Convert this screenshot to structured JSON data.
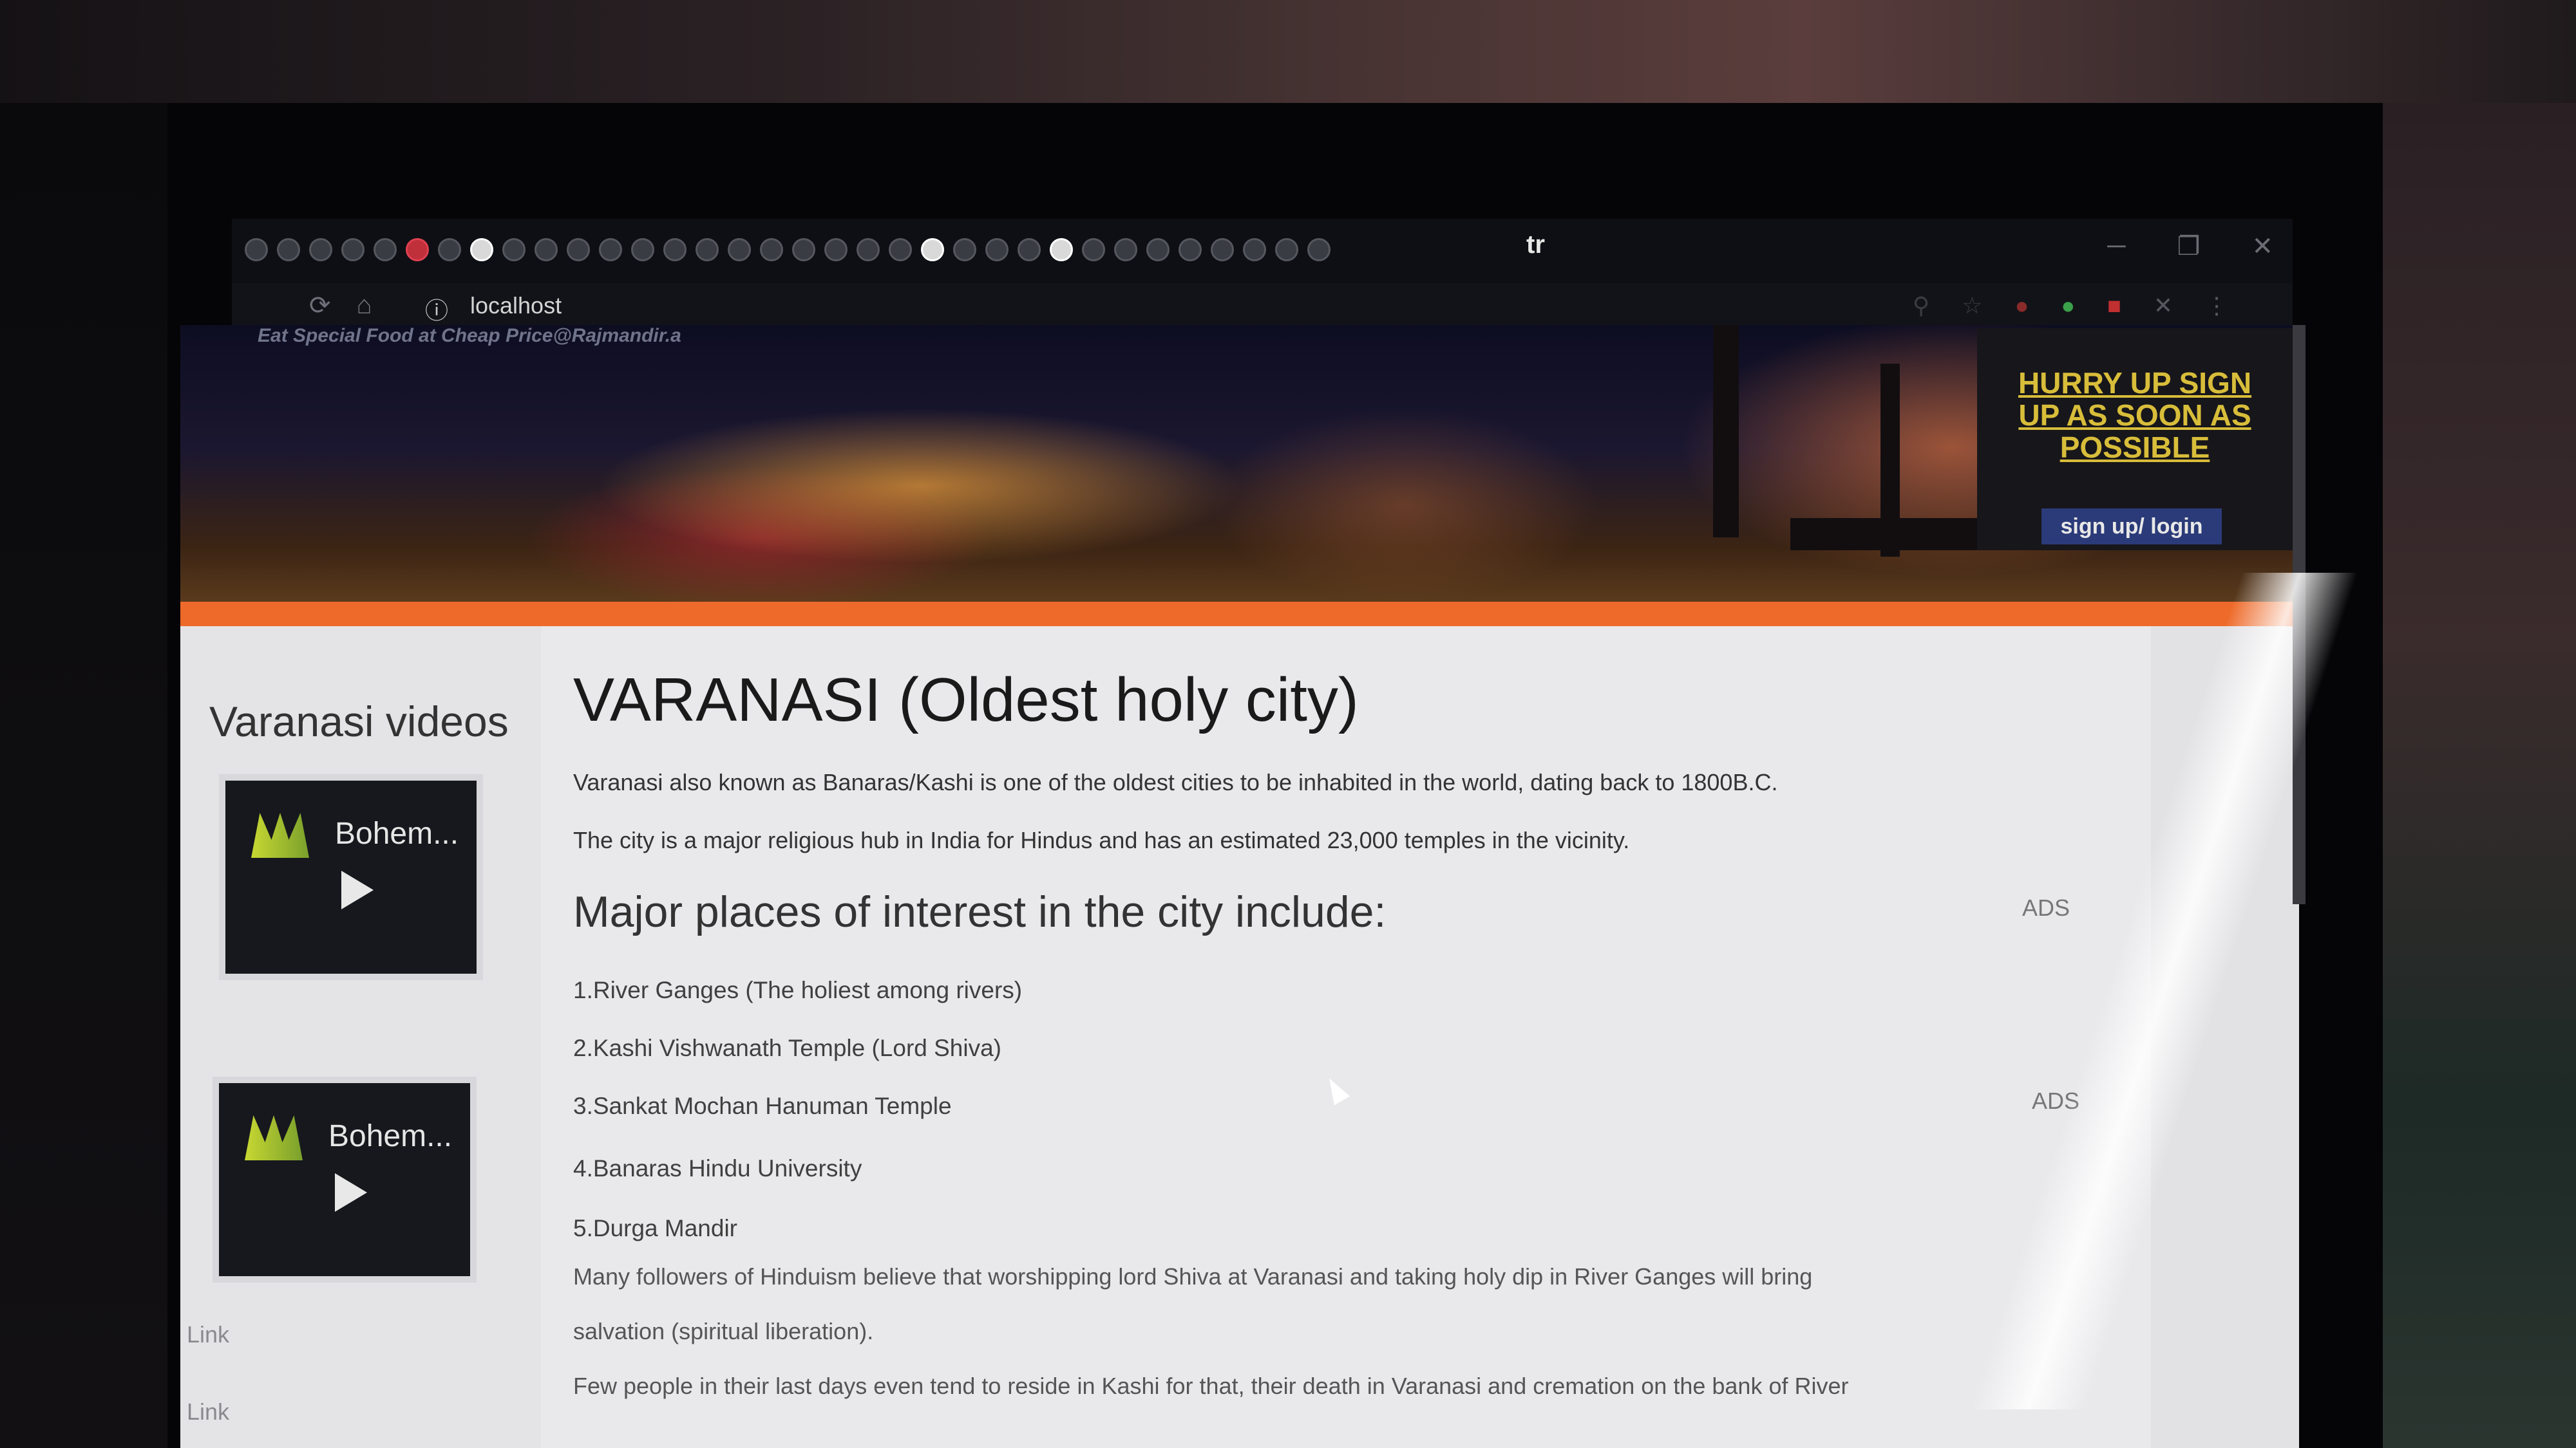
{
  "browser": {
    "tab_text": "tr",
    "address": "localhost"
  },
  "hero": {
    "caption": "Eat Special Food at Cheap Price@Rajmandir.a"
  },
  "sidebar": {
    "title": "Varanasi videos",
    "videos": [
      {
        "title": "Bohem..."
      },
      {
        "title": "Bohem..."
      }
    ],
    "links": [
      "Link",
      "Link"
    ]
  },
  "main": {
    "title": "VARANASI (Oldest holy city)",
    "intro": [
      "Varanasi also known as Banaras/Kashi is one of the oldest cities to be inhabited in the world, dating back to 1800B.C.",
      "The city is a major religious hub in India for Hindus and has an estimated 23,000 temples in the vicinity."
    ],
    "places_heading": "Major places of interest in the city include:",
    "places": [
      "1.River Ganges (The holiest among rivers)",
      "2.Kashi Vishwanath Temple (Lord Shiva)",
      "3.Sankat Mochan Hanuman Temple",
      "4.Banaras Hindu University",
      "5.Durga Mandir"
    ],
    "body": [
      "Many followers of Hinduism believe that worshipping lord Shiva at Varanasi and taking holy dip in River Ganges will bring",
      "salvation (spiritual liberation).",
      "Few people in their last days even tend to reside in Kashi for that, their death in Varanasi and cremation on the bank of River"
    ]
  },
  "ad": {
    "text": "HURRY UP SIGN UP AS SOON AS POSSIBLE",
    "button": "sign up/ login"
  },
  "ads_labels": [
    "ADS",
    "ADS"
  ],
  "colors": {
    "accent_strip": "#ee6a2a",
    "ad_text": "#d8bd3a",
    "ad_button": "#2b3a78"
  }
}
